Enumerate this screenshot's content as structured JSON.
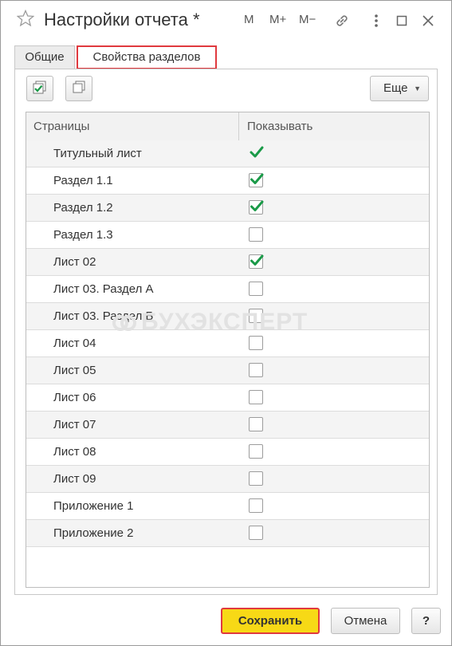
{
  "window": {
    "title": "Настройки отчета *",
    "controls": {
      "m": "M",
      "m_plus": "M+",
      "m_minus": "M−"
    },
    "icons": [
      "star-icon",
      "link-icon",
      "menu-icon",
      "maximize-icon",
      "close-icon"
    ]
  },
  "tabs": [
    {
      "label": "Общие",
      "active": false
    },
    {
      "label": "Свойства разделов",
      "active": true
    }
  ],
  "toolbar": {
    "check_all_icon": "check-all-icon",
    "uncheck_all_icon": "uncheck-all-icon",
    "more_label": "Еще"
  },
  "table": {
    "columns": [
      "Страницы",
      "Показывать"
    ],
    "rows": [
      {
        "name": "Титульный лист",
        "show": true,
        "mandatory": true
      },
      {
        "name": "Раздел 1.1",
        "show": true
      },
      {
        "name": "Раздел 1.2",
        "show": true
      },
      {
        "name": "Раздел 1.3",
        "show": false
      },
      {
        "name": "Лист 02",
        "show": true
      },
      {
        "name": "Лист 03. Раздел А",
        "show": false
      },
      {
        "name": "Лист 03. Раздел Б",
        "show": false
      },
      {
        "name": "Лист 04",
        "show": false
      },
      {
        "name": "Лист 05",
        "show": false
      },
      {
        "name": "Лист 06",
        "show": false
      },
      {
        "name": "Лист 07",
        "show": false
      },
      {
        "name": "Лист 08",
        "show": false
      },
      {
        "name": "Лист 09",
        "show": false
      },
      {
        "name": "Приложение 1",
        "show": false
      },
      {
        "name": "Приложение 2",
        "show": false
      }
    ]
  },
  "watermark": "БУХЭКСПЕРТ",
  "footer": {
    "save_label": "Сохранить",
    "cancel_label": "Отмена",
    "help_label": "?"
  },
  "colors": {
    "check": "#1a9a48",
    "save_bg": "#f7d916",
    "highlight": "#e0393e"
  }
}
